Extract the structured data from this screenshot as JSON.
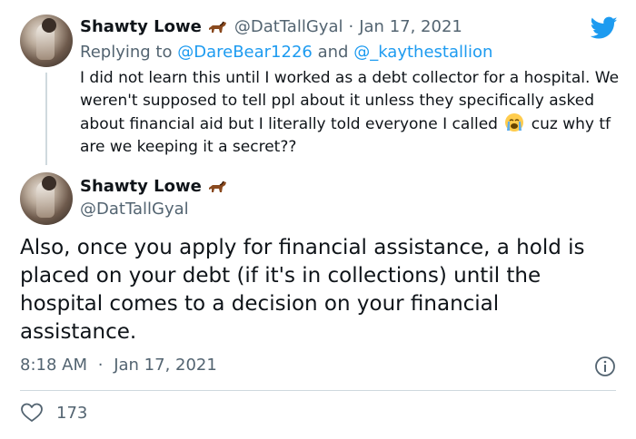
{
  "reply_tweet": {
    "display_name": "Shawty Lowe",
    "name_emoji": "horse-emoji",
    "handle": "@DatTallGyal",
    "separator": "·",
    "date": "Jan 17, 2021",
    "replying_prefix": "Replying to",
    "mention_1": "@DareBear1226",
    "mention_joiner": "and",
    "mention_2": "@_kaythestallion",
    "text_part_1": "I did not learn this until I worked as a debt collector for a hospital. We weren't supposed to tell ppl about it unless they specifically asked about financial aid but I literally told everyone I called",
    "text_emoji": "loudly-crying-face-emoji",
    "text_part_2": "cuz why tf are we keeping it a secret??"
  },
  "brand": {
    "icon": "twitter-bird-icon",
    "color": "#1d9bf0"
  },
  "main_tweet": {
    "display_name": "Shawty Lowe",
    "name_emoji": "horse-emoji",
    "handle": "@DatTallGyal",
    "text": "Also, once you apply for financial assistance, a hold is placed on your debt (if it's in collections) until the hospital comes to a decision on your financial assistance.",
    "time": "8:18 AM",
    "separator": "·",
    "date": "Jan 17, 2021",
    "like_count": "173"
  },
  "icons": {
    "info": "info-icon",
    "like": "heart-icon"
  }
}
